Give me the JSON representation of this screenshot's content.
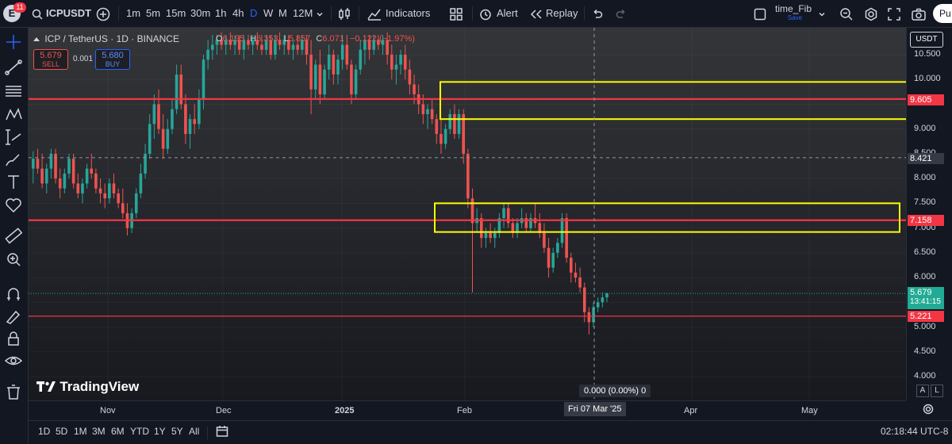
{
  "topbar": {
    "avatar_letter": "E",
    "notif_count": "11",
    "symbol": "ICPUSDT",
    "intervals": [
      "1m",
      "5m",
      "15m",
      "30m",
      "1h",
      "4h",
      "D",
      "W",
      "M",
      "12M"
    ],
    "active_interval": "D",
    "indicators_label": "Indicators",
    "alert_label": "Alert",
    "replay_label": "Replay",
    "layout_name": "time_Fib",
    "layout_sub": "Save",
    "publish_label": "Pu"
  },
  "legend": {
    "title": "ICP / TetherUS · 1D · BINANCE",
    "open_key": "O",
    "open": "6.195",
    "high_key": "H",
    "high": "6.353",
    "low_key": "L",
    "low": "5.857",
    "close_key": "C",
    "close": "6.071",
    "change": "−0.122 (−1.97%)",
    "sell_price": "5.679",
    "sell_label": "SELL",
    "spread": "0.001",
    "buy_price": "5.680",
    "buy_label": "BUY"
  },
  "watermark": "TradingView",
  "price_axis": {
    "currency": "USDT",
    "ticks": [
      "10.500",
      "10.000",
      "9.500",
      "9.000",
      "8.500",
      "8.000",
      "7.500",
      "7.000",
      "6.500",
      "6.000",
      "5.500",
      "5.000",
      "4.500",
      "4.000"
    ],
    "labels": {
      "level_top": "9.605",
      "crosshair": "8.421",
      "level_mid": "7.158",
      "last_price": "5.679",
      "countdown": "13:41:15",
      "level_low": "5.221"
    },
    "scale_auto": "A",
    "scale_log": "L"
  },
  "crosshair_readout": "0.000 (0.00%) 0",
  "time_axis": {
    "ticks": [
      "Nov",
      "Dec",
      "2025",
      "Feb",
      "Apr",
      "May"
    ],
    "crosshair_date": "Fri 07 Mar '25"
  },
  "bottombar": {
    "ranges": [
      "1D",
      "5D",
      "1M",
      "3M",
      "6M",
      "YTD",
      "1Y",
      "5Y",
      "All"
    ],
    "clock": "02:18:44 UTC-8"
  },
  "colors": {
    "up": "#26a69a",
    "down": "#ef5350",
    "level_line": "#f23645",
    "zone_box": "#ffff00",
    "last_price": "#22ab94",
    "buy_blue": "#2962ff"
  },
  "chart_data": {
    "type": "candlestick",
    "symbol": "ICP / TetherUS",
    "interval": "1D",
    "exchange": "BINANCE",
    "last_ohlc": {
      "open": 6.195,
      "high": 6.353,
      "low": 5.857,
      "close": 6.071,
      "change": -0.122,
      "change_pct": -1.97
    },
    "last_price": 5.679,
    "horizontal_levels": [
      9.605,
      7.158,
      5.221
    ],
    "zones": [
      {
        "from": 9.2,
        "to": 9.95,
        "color": "yellow"
      },
      {
        "from": 6.92,
        "to": 7.5,
        "color": "yellow"
      }
    ],
    "ylim": [
      4.0,
      10.7
    ],
    "ohlc": [
      [
        8.2,
        8.55,
        7.9,
        8.4
      ],
      [
        8.4,
        8.6,
        8.1,
        8.2
      ],
      [
        8.2,
        8.5,
        7.8,
        7.9
      ],
      [
        7.9,
        8.3,
        7.7,
        8.2
      ],
      [
        8.2,
        8.6,
        8.0,
        8.5
      ],
      [
        8.5,
        8.6,
        7.9,
        8.0
      ],
      [
        8.0,
        8.2,
        7.6,
        7.8
      ],
      [
        7.8,
        8.2,
        7.7,
        8.1
      ],
      [
        8.1,
        8.5,
        8.0,
        8.4
      ],
      [
        8.4,
        8.5,
        7.8,
        7.9
      ],
      [
        7.9,
        8.1,
        7.6,
        7.7
      ],
      [
        7.7,
        8.0,
        7.5,
        7.9
      ],
      [
        7.9,
        8.3,
        7.8,
        8.2
      ],
      [
        8.2,
        8.5,
        8.0,
        8.1
      ],
      [
        8.1,
        8.2,
        7.7,
        7.8
      ],
      [
        7.8,
        8.0,
        7.5,
        7.7
      ],
      [
        7.7,
        7.9,
        7.4,
        7.6
      ],
      [
        7.6,
        8.0,
        7.5,
        7.9
      ],
      [
        7.9,
        8.1,
        7.6,
        7.7
      ],
      [
        7.7,
        7.8,
        7.4,
        7.5
      ],
      [
        7.5,
        7.8,
        7.2,
        7.3
      ],
      [
        7.3,
        7.5,
        6.85,
        7.0
      ],
      [
        7.0,
        7.4,
        6.9,
        7.3
      ],
      [
        7.3,
        7.8,
        7.2,
        7.7
      ],
      [
        7.7,
        8.3,
        7.6,
        8.1
      ],
      [
        8.1,
        8.7,
        8.0,
        8.5
      ],
      [
        8.5,
        9.3,
        8.4,
        9.1
      ],
      [
        9.1,
        9.7,
        8.8,
        9.5
      ],
      [
        9.5,
        9.8,
        8.9,
        9.0
      ],
      [
        9.0,
        9.3,
        8.4,
        8.6
      ],
      [
        8.6,
        9.2,
        8.5,
        9.0
      ],
      [
        9.0,
        9.6,
        8.9,
        9.4
      ],
      [
        9.4,
        10.3,
        9.3,
        10.1
      ],
      [
        10.1,
        10.3,
        9.4,
        9.5
      ],
      [
        9.5,
        9.7,
        8.7,
        8.9
      ],
      [
        8.9,
        9.3,
        8.6,
        9.2
      ],
      [
        9.2,
        9.5,
        8.9,
        9.1
      ],
      [
        9.1,
        9.8,
        9.0,
        9.6
      ],
      [
        9.6,
        10.5,
        9.4,
        10.4
      ],
      [
        10.4,
        10.8,
        10.2,
        10.6
      ],
      [
        10.6,
        10.9,
        10.4,
        10.7
      ],
      [
        10.7,
        10.9,
        10.5,
        10.8
      ],
      [
        10.8,
        10.95,
        10.6,
        10.7
      ],
      [
        10.7,
        10.9,
        10.5,
        10.8
      ],
      [
        10.8,
        10.95,
        10.6,
        10.7
      ],
      [
        10.7,
        10.9,
        10.5,
        10.8
      ],
      [
        10.8,
        10.9,
        10.5,
        10.6
      ],
      [
        10.6,
        10.9,
        10.4,
        10.8
      ],
      [
        10.8,
        10.9,
        10.6,
        10.7
      ],
      [
        10.7,
        10.9,
        10.5,
        10.8
      ],
      [
        10.8,
        10.95,
        10.6,
        10.7
      ],
      [
        10.7,
        10.9,
        10.5,
        10.6
      ],
      [
        10.6,
        10.9,
        10.5,
        10.8
      ],
      [
        10.8,
        10.9,
        10.4,
        10.5
      ],
      [
        10.5,
        10.9,
        10.4,
        10.8
      ],
      [
        10.8,
        10.95,
        10.6,
        10.7
      ],
      [
        10.7,
        10.9,
        10.5,
        10.8
      ],
      [
        10.8,
        10.9,
        10.5,
        10.6
      ],
      [
        10.6,
        10.8,
        10.4,
        10.7
      ],
      [
        10.7,
        10.9,
        10.5,
        10.6
      ],
      [
        10.6,
        10.9,
        10.5,
        10.8
      ],
      [
        10.8,
        10.9,
        10.3,
        10.5
      ],
      [
        10.5,
        10.8,
        9.3,
        9.8
      ],
      [
        9.8,
        10.4,
        9.6,
        10.3
      ],
      [
        10.3,
        10.6,
        9.5,
        9.7
      ],
      [
        9.7,
        10.3,
        9.6,
        10.2
      ],
      [
        10.2,
        10.7,
        10.0,
        10.5
      ],
      [
        10.5,
        10.6,
        9.9,
        10.1
      ],
      [
        10.1,
        10.5,
        9.9,
        10.4
      ],
      [
        10.4,
        10.9,
        10.2,
        10.7
      ],
      [
        10.7,
        10.9,
        10.2,
        10.3
      ],
      [
        10.3,
        10.4,
        9.5,
        9.7
      ],
      [
        9.7,
        10.3,
        9.6,
        10.2
      ],
      [
        10.2,
        10.8,
        10.1,
        10.6
      ],
      [
        10.6,
        10.9,
        10.3,
        10.8
      ],
      [
        10.8,
        10.9,
        10.4,
        10.6
      ],
      [
        10.6,
        10.9,
        10.5,
        10.8
      ],
      [
        10.8,
        10.9,
        10.6,
        10.7
      ],
      [
        10.7,
        10.9,
        10.5,
        10.8
      ],
      [
        10.8,
        10.95,
        10.3,
        10.5
      ],
      [
        10.5,
        10.7,
        10.0,
        10.2
      ],
      [
        10.2,
        10.5,
        9.9,
        10.3
      ],
      [
        10.3,
        10.6,
        10.1,
        10.5
      ],
      [
        10.5,
        10.7,
        10.0,
        10.2
      ],
      [
        10.2,
        10.4,
        9.7,
        9.9
      ],
      [
        9.9,
        10.1,
        9.5,
        9.7
      ],
      [
        9.7,
        9.9,
        9.3,
        9.5
      ],
      [
        9.5,
        9.7,
        9.1,
        9.3
      ],
      [
        9.3,
        9.5,
        9.0,
        9.4
      ],
      [
        9.4,
        9.6,
        9.1,
        9.2
      ],
      [
        9.2,
        9.3,
        8.7,
        8.9
      ],
      [
        8.9,
        9.2,
        8.5,
        8.7
      ],
      [
        8.7,
        9.1,
        8.6,
        9.0
      ],
      [
        9.0,
        9.4,
        8.9,
        9.3
      ],
      [
        9.3,
        9.5,
        8.8,
        8.9
      ],
      [
        8.9,
        9.4,
        8.8,
        9.3
      ],
      [
        9.3,
        9.4,
        8.3,
        8.5
      ],
      [
        8.5,
        8.6,
        7.4,
        7.6
      ],
      [
        7.6,
        7.8,
        5.7,
        7.1
      ],
      [
        7.1,
        7.4,
        6.9,
        7.2
      ],
      [
        7.2,
        7.3,
        6.6,
        6.8
      ],
      [
        6.8,
        7.0,
        6.6,
        6.9
      ],
      [
        6.9,
        7.1,
        6.7,
        6.8
      ],
      [
        6.8,
        7.0,
        6.6,
        6.9
      ],
      [
        6.9,
        7.3,
        6.8,
        7.2
      ],
      [
        7.2,
        7.5,
        7.0,
        7.4
      ],
      [
        7.4,
        7.5,
        7.0,
        7.1
      ],
      [
        7.1,
        7.2,
        6.8,
        6.9
      ],
      [
        6.9,
        7.2,
        6.8,
        7.1
      ],
      [
        7.1,
        7.4,
        7.0,
        7.2
      ],
      [
        7.2,
        7.3,
        6.9,
        7.0
      ],
      [
        7.0,
        7.3,
        6.9,
        7.2
      ],
      [
        7.2,
        7.5,
        7.0,
        7.1
      ],
      [
        7.1,
        7.3,
        6.8,
        6.9
      ],
      [
        6.9,
        7.1,
        6.5,
        6.6
      ],
      [
        6.6,
        6.8,
        6.0,
        6.2
      ],
      [
        6.2,
        6.6,
        6.1,
        6.5
      ],
      [
        6.5,
        6.8,
        6.4,
        6.7
      ],
      [
        6.7,
        7.3,
        6.6,
        7.2
      ],
      [
        7.2,
        7.3,
        6.3,
        6.4
      ],
      [
        6.4,
        6.5,
        5.9,
        6.1
      ],
      [
        6.1,
        6.3,
        5.9,
        6.0
      ],
      [
        6.0,
        6.2,
        5.7,
        5.8
      ],
      [
        5.8,
        5.9,
        5.1,
        5.3
      ],
      [
        5.3,
        5.4,
        4.85,
        5.1
      ],
      [
        5.1,
        5.5,
        5.0,
        5.4
      ],
      [
        5.4,
        5.6,
        5.3,
        5.5
      ],
      [
        5.5,
        5.7,
        5.4,
        5.6
      ],
      [
        5.6,
        5.7,
        5.5,
        5.68
      ]
    ]
  }
}
